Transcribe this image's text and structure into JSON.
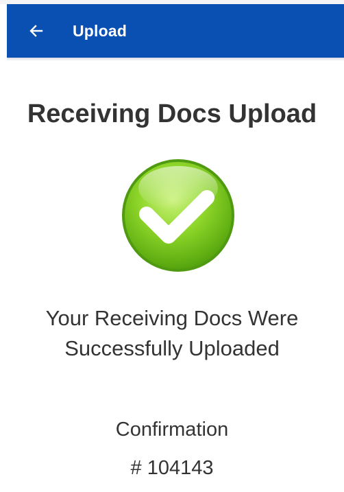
{
  "app_bar": {
    "title": "Upload",
    "back_icon": "arrow-left-icon",
    "background_color": "#0a4fb2"
  },
  "page": {
    "title": "Receiving Docs Upload",
    "status_icon": "success-checkmark-icon",
    "status_color": "#7fcc1c",
    "message_line1": "Your Receiving Docs Were",
    "message_line2": "Successfully Uploaded",
    "confirmation_label": "Confirmation",
    "confirmation_number": "# 104143"
  }
}
